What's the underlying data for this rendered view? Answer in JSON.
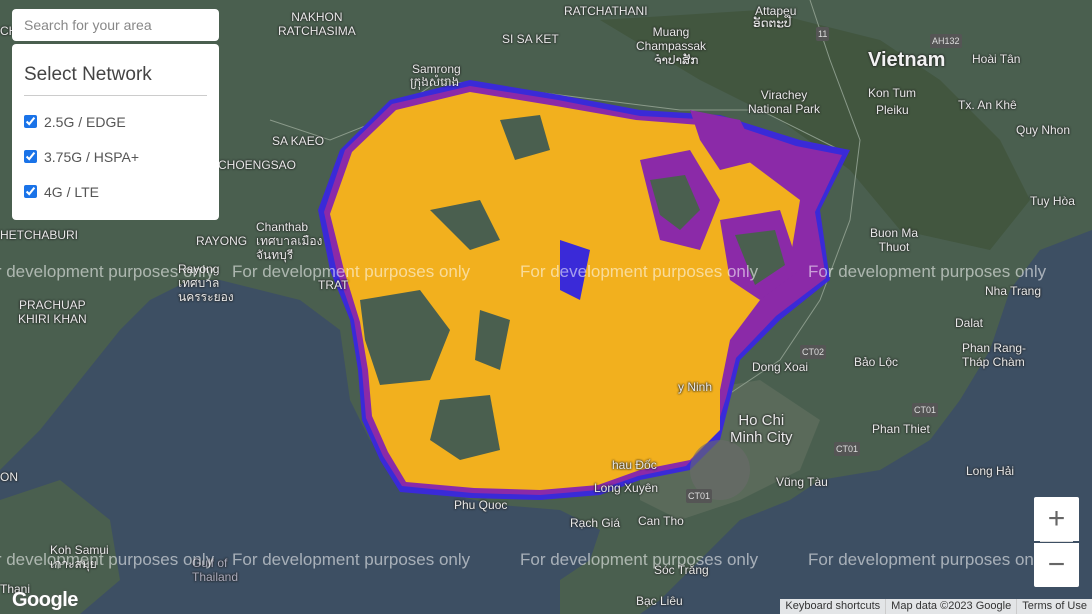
{
  "search": {
    "placeholder": "Search for your area"
  },
  "panel": {
    "title": "Select Network",
    "networks": [
      {
        "label": "2.5G / EDGE",
        "checked": true
      },
      {
        "label": "3.75G / HSPA+",
        "checked": true
      },
      {
        "label": "4G / LTE",
        "checked": true
      }
    ]
  },
  "map": {
    "watermark": "For development purposes only",
    "colors": {
      "land": "#4a5f4f",
      "sea": "#3d4f63",
      "coverage_lte": "#f2b01e",
      "coverage_hspa": "#8b2aa8",
      "coverage_edge": "#3a2ad8"
    },
    "places": {
      "chai_na": "CHAI NA",
      "nakhon_ratchasima": "NAKHON\nRATCHASIMA",
      "ratchathani": "RATCHATHANI",
      "ratchathani_lao": "ຈຳປາສັກ",
      "attapeu": "Attapeu",
      "attapeu_lao": "ອັດຕະປື",
      "si_sa_ket": "SI SA KET",
      "muang_champassak": "Muang\nChampassak",
      "champassak_lao": "ຈຳປາສັກ",
      "samrong": "Samrong",
      "samrong_khmer": "ក្រុងសំរោង",
      "virachey": "Virachey\nNational Park",
      "vietnam": "Vietnam",
      "kon_tum": "Kon Tum",
      "pleiku": "Pleiku",
      "hoai_tan": "Hoài Tân",
      "tx_an_khe": "Tx. An Khê",
      "quy_nhon": "Quy Nhon",
      "sa_kaeo": "SA KAEO",
      "chachoengsao": "CHOENGSAO",
      "chanthaburi": "Chanthab",
      "tuy_hoa": "Tuy Hòa",
      "rayong": "RAYONG",
      "rayong_th": "เทศบาลเมือง\nจันทบุรี",
      "chetchaburi": "HETCHABURI",
      "buon_ma_thuot": "Buon Ma\nThuot",
      "nha_trang": "Nha Trang",
      "rayong_city": "Rayong\nเทศบาล\nนครระยอง",
      "trat": "TRAT",
      "prachuap": "PRACHUAP\nKHIRI KHAN",
      "dalat": "Dalat",
      "phan_rang": "Phan Rang-\nTháp Chàm",
      "bao_loc": "Bảo Lộc",
      "dong_xoai": "Dong Xoai",
      "tay_ninh": "y Ninh",
      "ho_chi_minh": "Ho Chi\nMinh City",
      "phan_thiet": "Phan Thiet",
      "on": "ON",
      "long_hai": "Long Hải",
      "chau_doc": "hau Đốc",
      "long_xuyen": "Long Xuyên",
      "vung_tau": "Vũng Tàu",
      "phu_quoc": "Phu Quoc",
      "rach_gia": "Rạch Giá",
      "can_tho": "Can Tho",
      "koh_samui": "Koh Samui\nเกาะสมุย",
      "gulf_thailand": "Gulf of\nThailand",
      "soc_trang": "Sóc Trăng",
      "bac_lieu": "Bạc Liêu",
      "thani": "Thani"
    },
    "road_shields": [
      "AH132",
      "11",
      "CT02",
      "CT01",
      "CT01",
      "CT01"
    ]
  },
  "controls": {
    "zoom_in": "+",
    "zoom_out": "−"
  },
  "attribution": {
    "shortcuts": "Keyboard shortcuts",
    "map_data": "Map data ©2023 Google",
    "terms": "Terms of Use"
  },
  "logo": "Google"
}
